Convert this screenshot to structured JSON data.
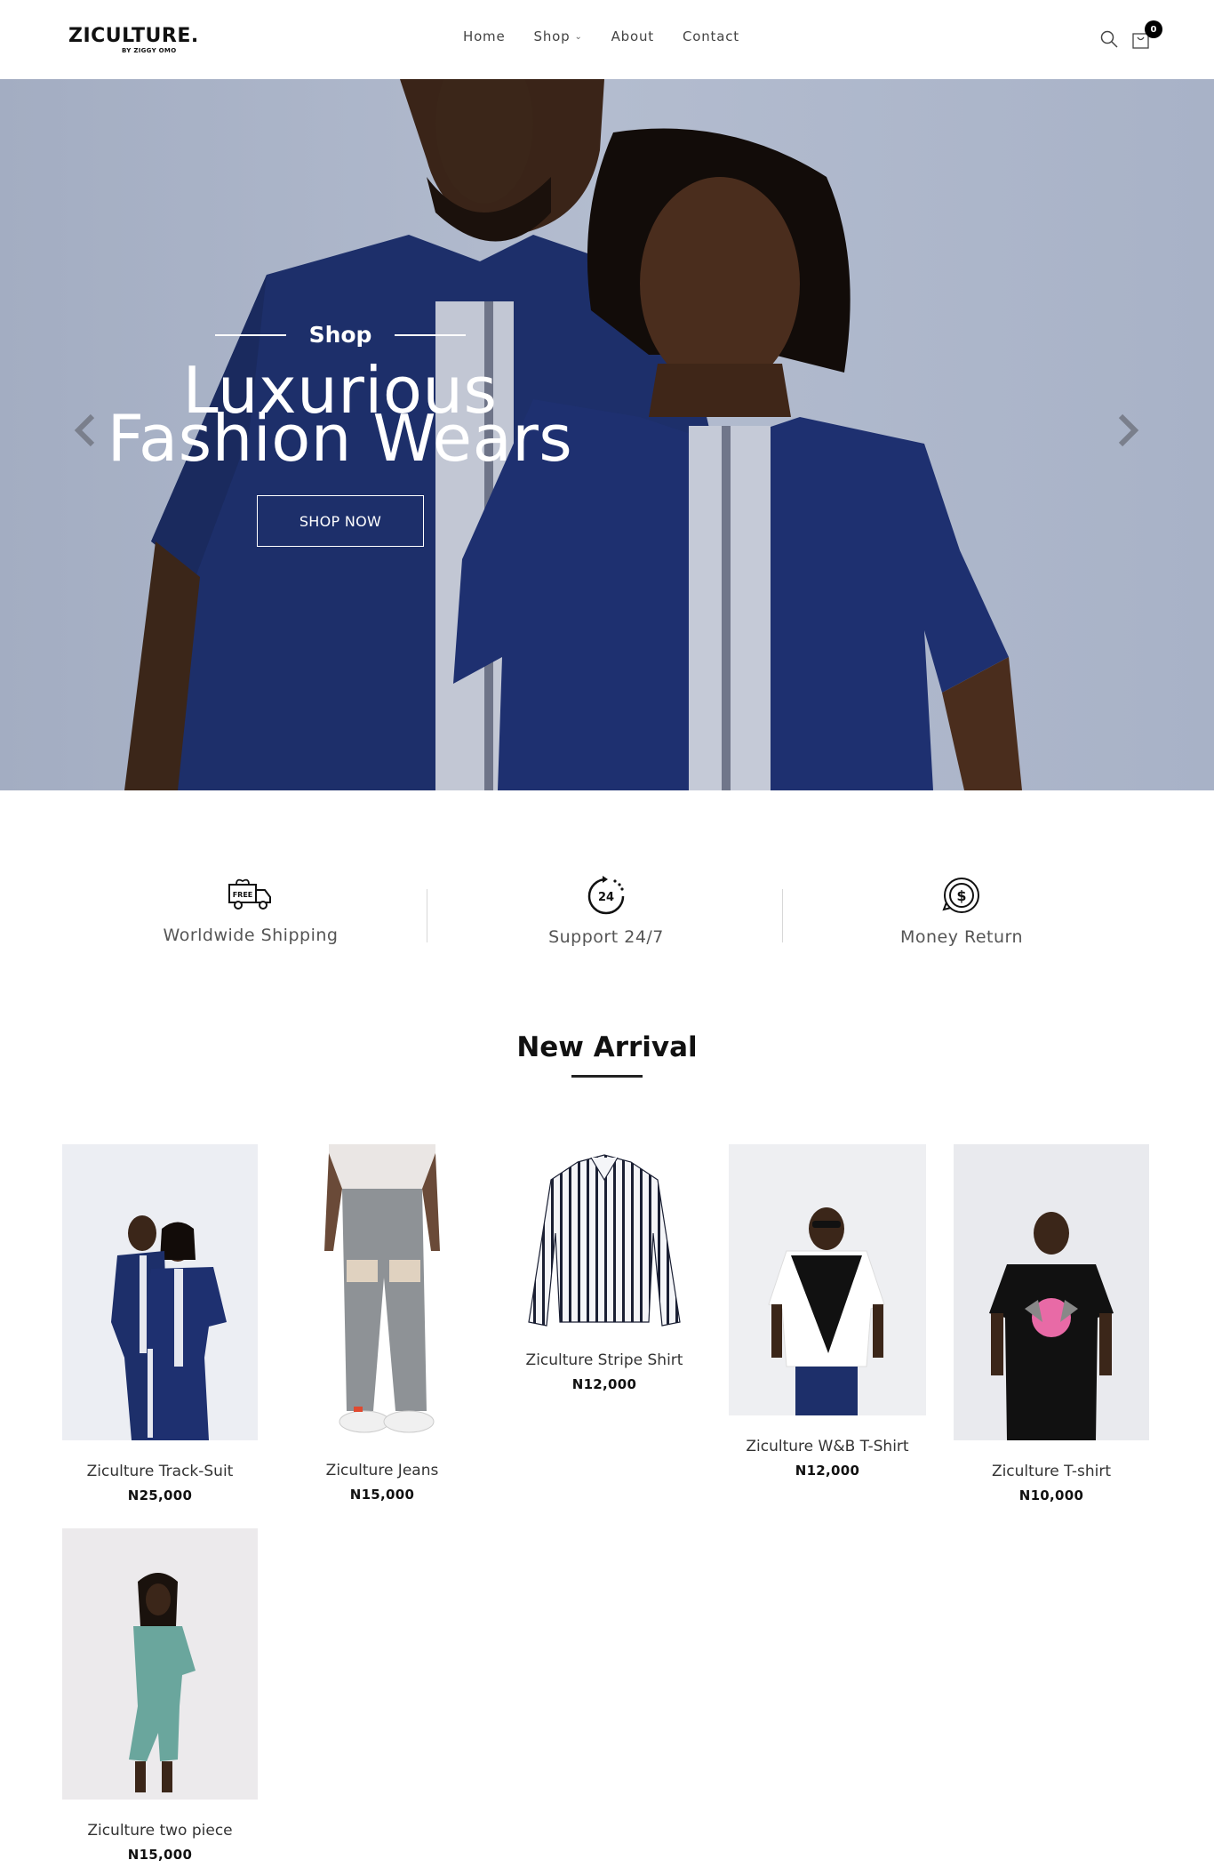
{
  "header": {
    "logo": "ZICULTURE.",
    "logo_sub": "BY ZIGGY OMO",
    "nav": [
      {
        "label": "Home"
      },
      {
        "label": "Shop"
      },
      {
        "label": "About"
      },
      {
        "label": "Contact"
      }
    ],
    "cart_count": "0"
  },
  "hero": {
    "eyebrow": "Shop",
    "title_line1": "Luxurious",
    "title_line2": "Fashion Wears",
    "button": "SHOP NOW"
  },
  "features": [
    {
      "label": "Worldwide Shipping",
      "icon": "free-shipping-truck-icon",
      "badge": "FREE"
    },
    {
      "label": "Support 24/7",
      "icon": "support-24-icon",
      "badge": "24"
    },
    {
      "label": "Money Return",
      "icon": "money-return-icon"
    }
  ],
  "section": {
    "title": "New Arrival"
  },
  "products": [
    {
      "name": "Ziculture Track-Suit",
      "price": "N25,000"
    },
    {
      "name": "Ziculture Jeans",
      "price": "N15,000"
    },
    {
      "name": "Ziculture Stripe Shirt",
      "price": "N12,000"
    },
    {
      "name": "Ziculture W&B T-Shirt",
      "price": "N12,000"
    },
    {
      "name": "Ziculture T-shirt",
      "price": "N10,000"
    },
    {
      "name": "Ziculture two piece",
      "price": "N15,000"
    }
  ],
  "colors": {
    "hero_bg": "#a9b3c9",
    "garment_navy": "#1c2f6b",
    "text_dark": "#111111"
  }
}
